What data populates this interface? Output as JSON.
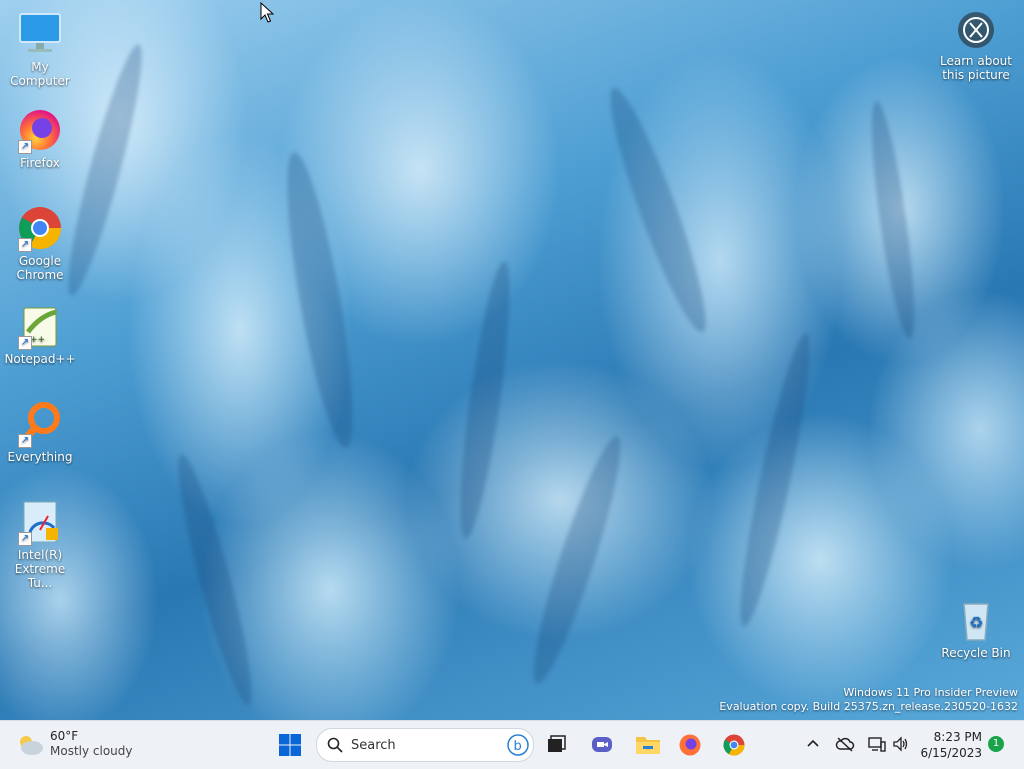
{
  "desktop": {
    "icons": [
      {
        "label": "My Computer"
      },
      {
        "label": "Firefox"
      },
      {
        "label": "Google Chrome"
      },
      {
        "label": "Notepad++"
      },
      {
        "label": "Everything"
      },
      {
        "label": "Intel(R) Extreme Tu..."
      },
      {
        "label": "Recycle Bin"
      }
    ],
    "learn_about": "Learn about this picture",
    "watermark_line1": "Windows 11 Pro Insider Preview",
    "watermark_line2": "Evaluation copy. Build 25375.zn_release.230520-1632"
  },
  "taskbar": {
    "weather_temp": "60°F",
    "weather_desc": "Mostly cloudy",
    "search_placeholder": "Search",
    "time": "8:23 PM",
    "date": "6/15/2023",
    "notification_count": "1"
  },
  "colors": {
    "start_blue": "#0a66d8",
    "taskbar_bg": "#eef2f6"
  }
}
